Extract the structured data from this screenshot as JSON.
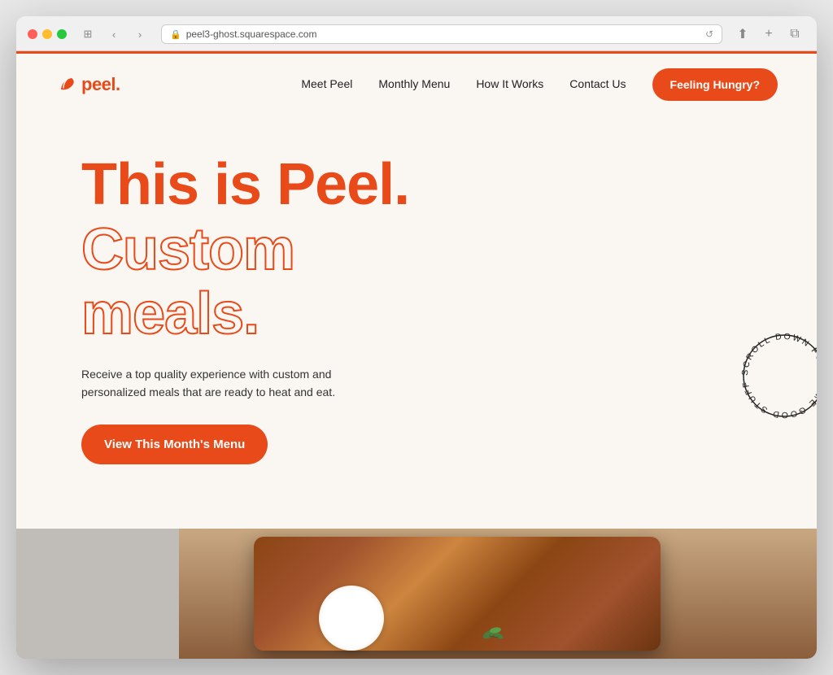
{
  "browser": {
    "url": "peel3-ghost.squarespace.com",
    "reload_icon": "↺"
  },
  "navbar": {
    "logo_text": "peel.",
    "nav_links": [
      {
        "label": "Meet Peel",
        "id": "meet-peel"
      },
      {
        "label": "Monthly Menu",
        "id": "monthly-menu"
      },
      {
        "label": "How It Works",
        "id": "how-it-works"
      },
      {
        "label": "Contact Us",
        "id": "contact-us"
      }
    ],
    "cta_label": "Feeling Hungry?"
  },
  "hero": {
    "title_solid": "This is Peel.",
    "title_outline_line1": "Custom",
    "title_outline_line2": "meals.",
    "subtitle": "Receive a top quality experience with custom and personalized meals that are ready to heat and eat.",
    "cta_label": "View This Month's Menu"
  },
  "scroll_badge": {
    "text": "SCROLL DOWN FOR SOME GOOD STUFF –"
  },
  "colors": {
    "brand_orange": "#e84a1a",
    "page_bg": "#faf7f2"
  }
}
